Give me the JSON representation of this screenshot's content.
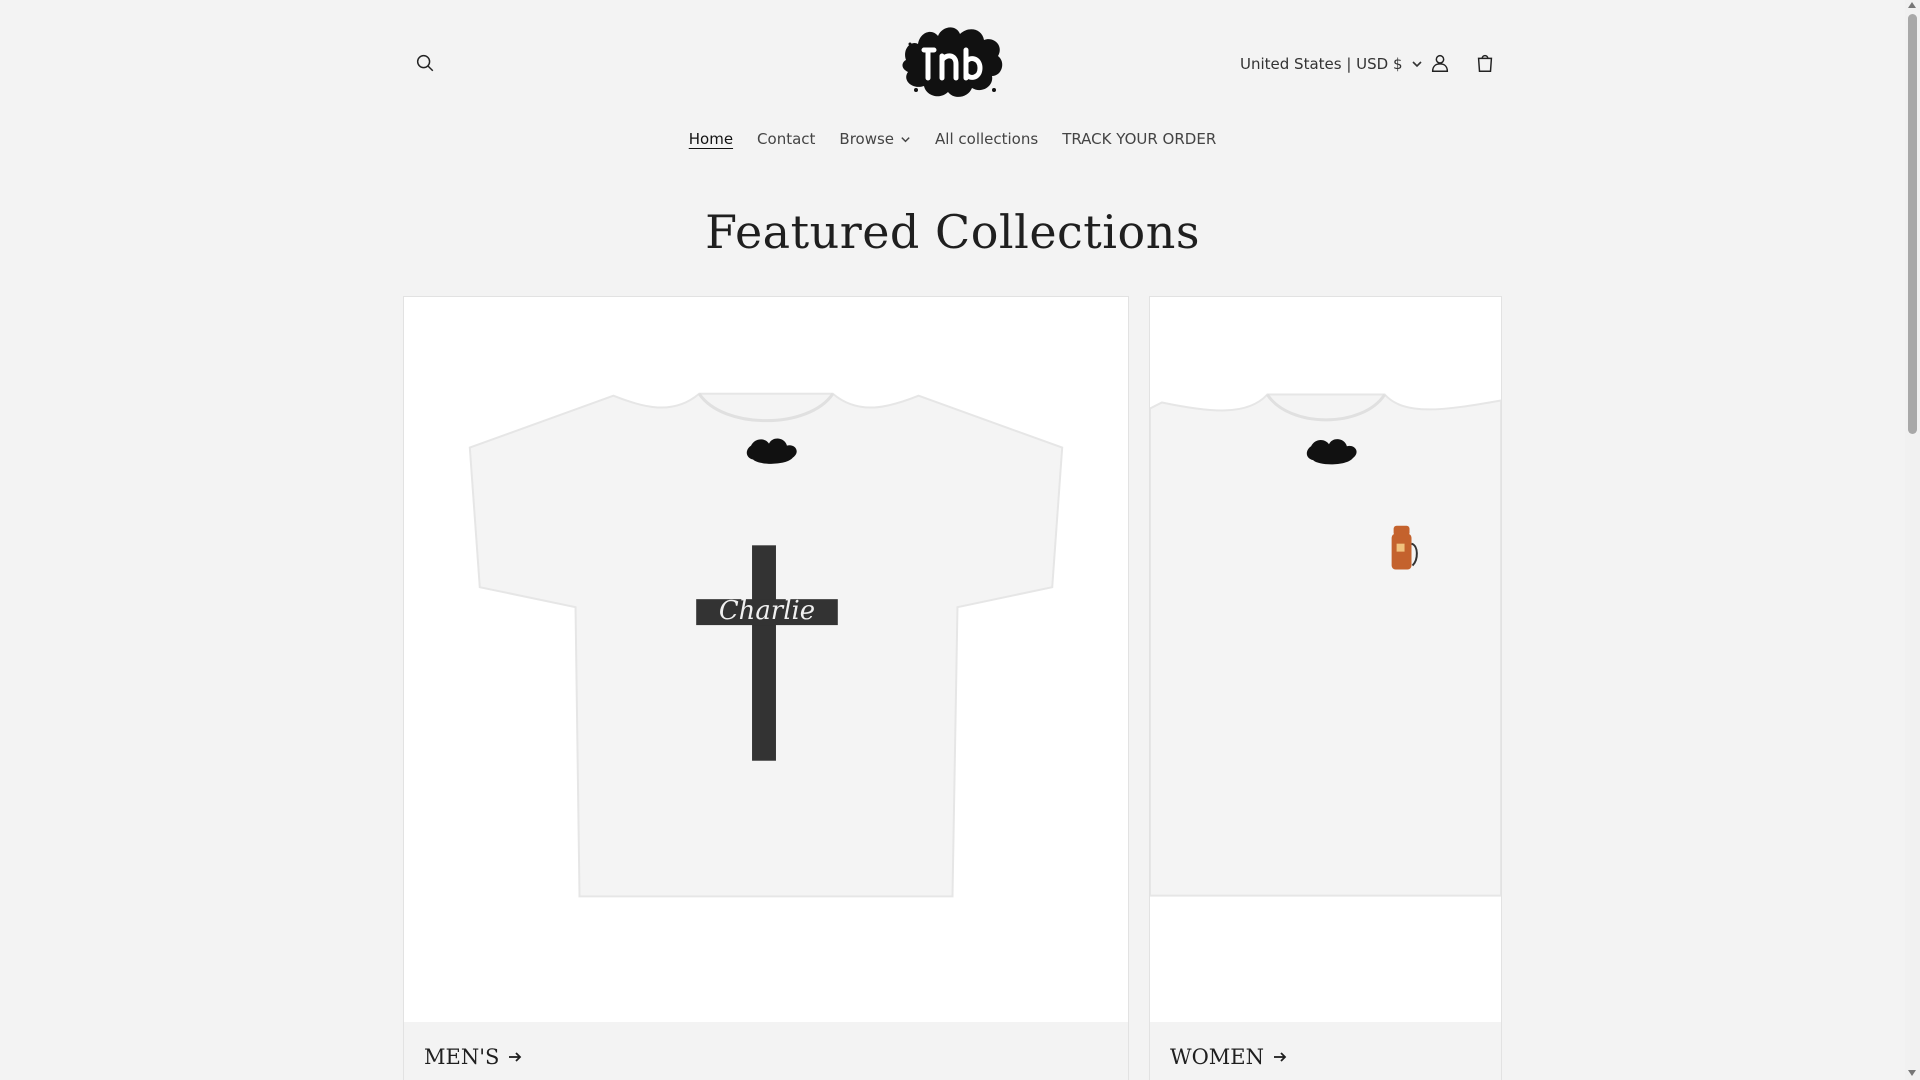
{
  "header": {
    "search_icon": "search-icon",
    "logo_icon": "brand-logo",
    "currency_label": "United States | USD $",
    "account_icon": "user-icon",
    "cart_icon": "cart-icon"
  },
  "nav": {
    "items": [
      {
        "label": "Home",
        "active": true
      },
      {
        "label": "Contact"
      },
      {
        "label": "Browse",
        "has_dropdown": true
      },
      {
        "label": "All collections"
      },
      {
        "label": "TRACK YOUR ORDER"
      }
    ]
  },
  "main": {
    "heading": "Featured Collections",
    "collections": [
      {
        "label": "MEN'S",
        "image_text": "Charlie"
      },
      {
        "label": "WOMEN"
      }
    ]
  },
  "colors": {
    "page_bg": "#f3f3f3",
    "card_bg": "#ffffff",
    "text": "#121212"
  }
}
